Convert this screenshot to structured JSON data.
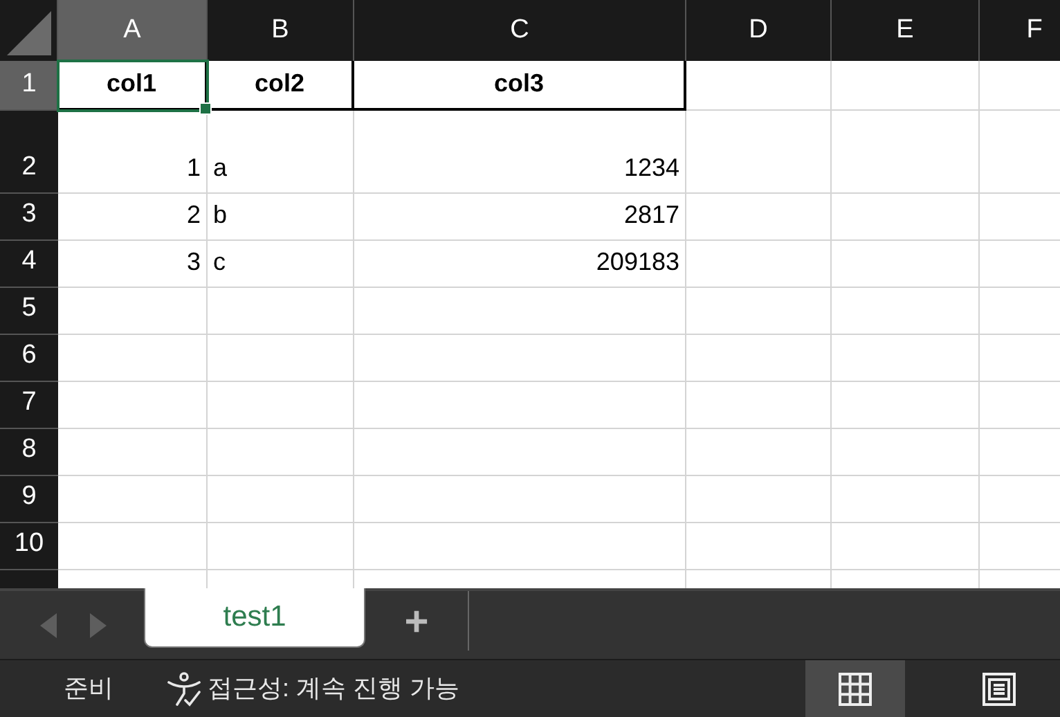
{
  "columns": [
    {
      "label": "A",
      "selected": true
    },
    {
      "label": "B",
      "selected": false
    },
    {
      "label": "C",
      "selected": false
    },
    {
      "label": "D",
      "selected": false
    },
    {
      "label": "E",
      "selected": false
    },
    {
      "label": "F",
      "selected": false
    }
  ],
  "rows": [
    {
      "label": "1",
      "selected": true,
      "kind": "header",
      "cells": [
        "col1",
        "col2",
        "col3"
      ]
    },
    {
      "label": "2",
      "selected": false,
      "kind": "data",
      "cells": [
        "1",
        "a",
        "1234"
      ]
    },
    {
      "label": "3",
      "selected": false,
      "kind": "data",
      "cells": [
        "2",
        "b",
        "2817"
      ]
    },
    {
      "label": "4",
      "selected": false,
      "kind": "data",
      "cells": [
        "3",
        "c",
        "209183"
      ]
    },
    {
      "label": "5",
      "selected": false,
      "kind": "data",
      "cells": []
    },
    {
      "label": "6",
      "selected": false,
      "kind": "data",
      "cells": []
    },
    {
      "label": "7",
      "selected": false,
      "kind": "data",
      "cells": []
    },
    {
      "label": "8",
      "selected": false,
      "kind": "data",
      "cells": []
    },
    {
      "label": "9",
      "selected": false,
      "kind": "data",
      "cells": []
    },
    {
      "label": "10",
      "selected": false,
      "kind": "data",
      "cells": []
    }
  ],
  "sheet_tabs": [
    {
      "label": "test1",
      "selected": true
    }
  ],
  "add_sheet": "+",
  "status_bar": {
    "mode": "준비",
    "accessibility": "접근성: 계속 진행 가능",
    "views": [
      {
        "kind": "normal",
        "selected": true
      },
      {
        "kind": "page",
        "selected": false
      }
    ]
  }
}
